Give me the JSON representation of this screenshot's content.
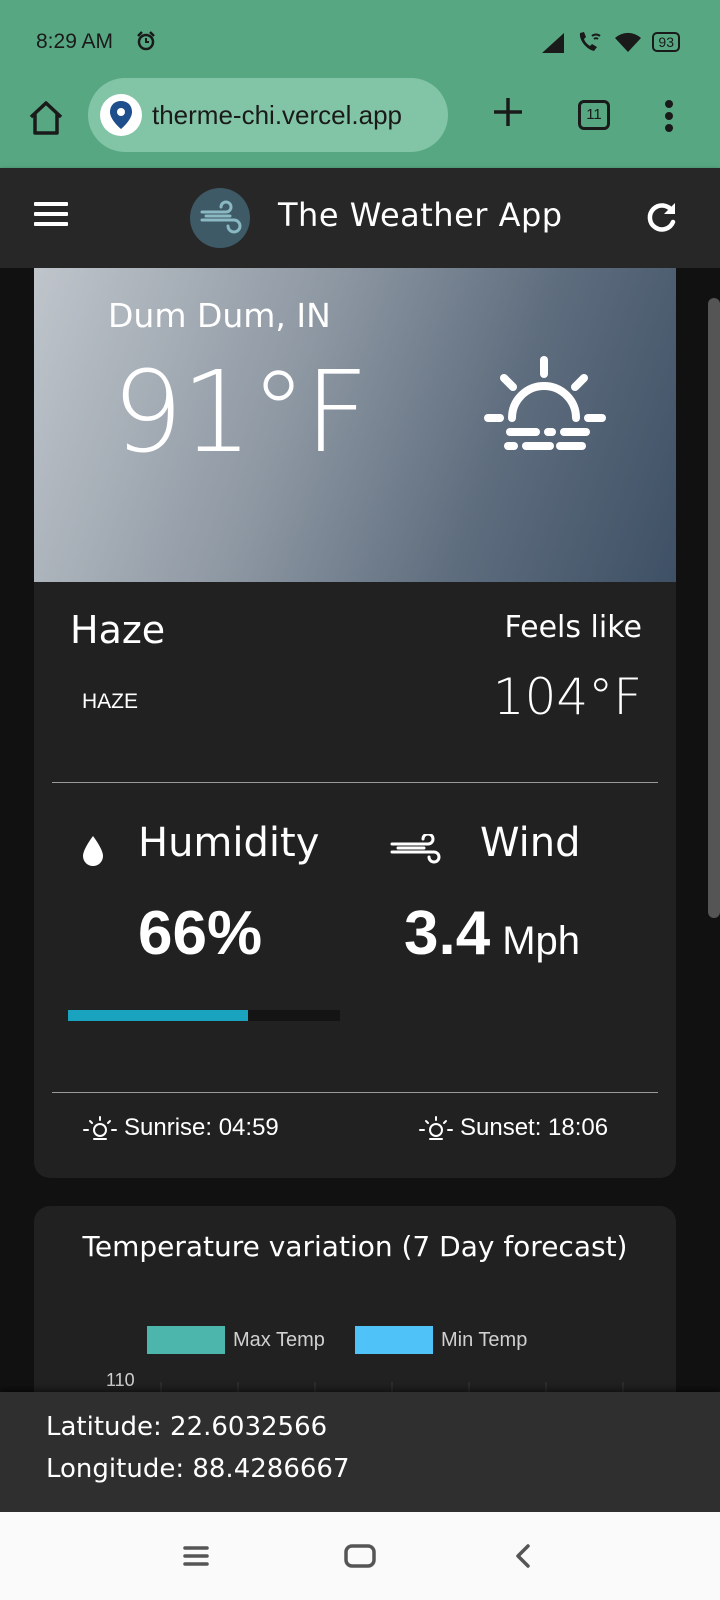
{
  "status": {
    "time": "8:29 AM",
    "battery": "93"
  },
  "browser": {
    "url": "therme-chi.vercel.app",
    "tab_count": "11"
  },
  "app": {
    "title": "The Weather App"
  },
  "current": {
    "location": "Dum Dum, IN",
    "temperature": "91°F",
    "condition": "Haze",
    "condition_detail": "HAZE",
    "feels_like_label": "Feels like",
    "feels_like_value": "104°F",
    "humidity_label": "Humidity",
    "humidity_value": "66%",
    "humidity_fraction": 0.66,
    "wind_label": "Wind",
    "wind_value": "3.4",
    "wind_unit": "Mph",
    "sunrise": "Sunrise: 04:59",
    "sunset": "Sunset: 18:06"
  },
  "chart": {
    "title": "Temperature variation (7 Day forecast)",
    "legend_max": "Max Temp",
    "legend_min": "Min Temp",
    "max_color": "#4db6ac",
    "min_color": "#4fc3f7",
    "ytick_top": "110"
  },
  "chart_data": {
    "type": "bar",
    "title": "Temperature variation (7 Day forecast)",
    "series": [
      {
        "name": "Max Temp",
        "values": []
      },
      {
        "name": "Min Temp",
        "values": []
      }
    ],
    "yticks": [
      110
    ],
    "legend": "top"
  },
  "coords": {
    "latitude": "Latitude: 22.6032566",
    "longitude": "Longitude: 88.4286667"
  },
  "colors": {
    "status_bar": "#57a882",
    "app_bar": "#272727",
    "card": "#212121",
    "humidity_bar": "#1aa3bf"
  }
}
